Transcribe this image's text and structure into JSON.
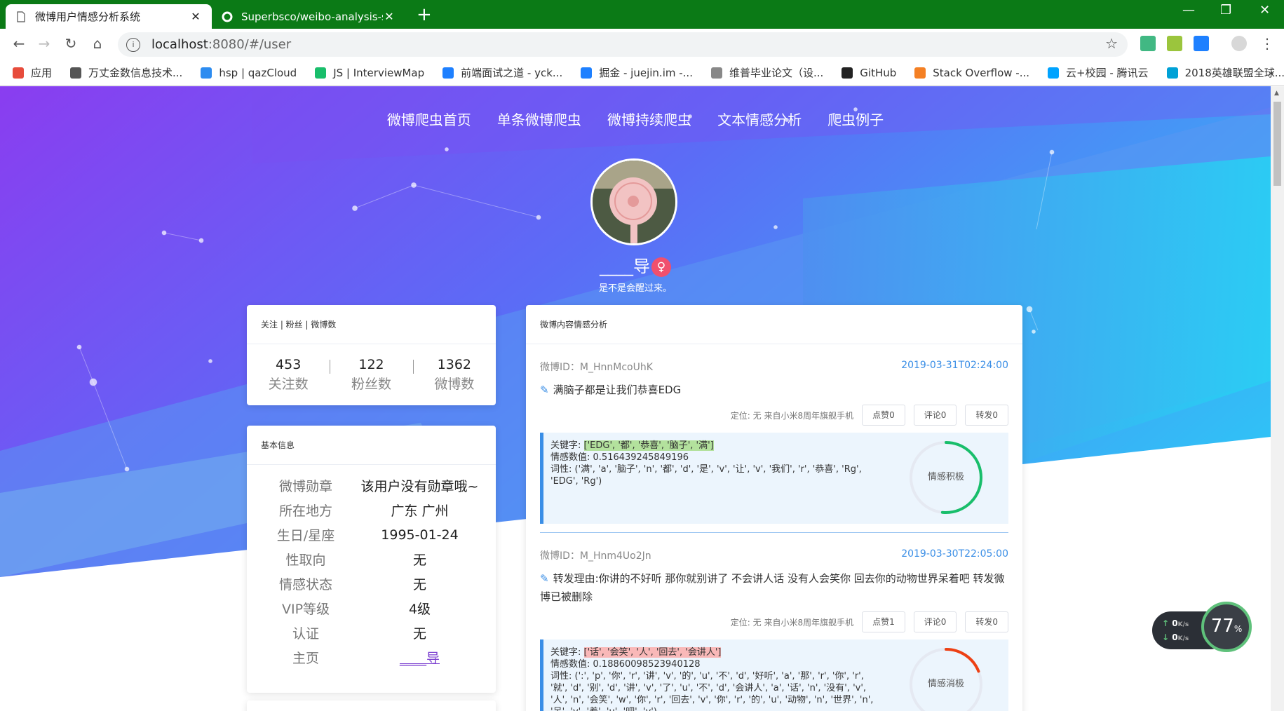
{
  "browser": {
    "tabs": [
      {
        "title": "微博用户情感分析系统",
        "close": "✕"
      },
      {
        "title": "Superbsco/weibo-analysis-syst",
        "close": "✕"
      }
    ],
    "new_tab": "+",
    "url_host": "localhost",
    "url_rest": ":8080/#/user",
    "bookmarks": [
      {
        "label": "应用",
        "icon": "apps-icon",
        "color": "#e74c3c"
      },
      {
        "label": "万丈金数信息技术...",
        "icon": "aws-icon",
        "color": "#555555"
      },
      {
        "label": "hsp | qazCloud",
        "icon": "cloud-icon",
        "color": "#2d8cf0"
      },
      {
        "label": "JS | InterviewMap",
        "icon": "map-icon",
        "color": "#19be6b"
      },
      {
        "label": "前端面试之道 - yck...",
        "icon": "juejin-icon",
        "color": "#1e80ff"
      },
      {
        "label": "掘金 - juejin.im -...",
        "icon": "juejin-icon",
        "color": "#1e80ff"
      },
      {
        "label": "维普毕业论文（设...",
        "icon": "doc-icon",
        "color": "#888888"
      },
      {
        "label": "GitHub",
        "icon": "github-icon",
        "color": "#222222"
      },
      {
        "label": "Stack Overflow -...",
        "icon": "stackoverflow-icon",
        "color": "#f48024"
      },
      {
        "label": "云+校园 - 腾讯云",
        "icon": "tencent-cloud-icon",
        "color": "#00a3ff"
      },
      {
        "label": "2018英雄联盟全球...",
        "icon": "bilibili-icon",
        "color": "#00a1d6"
      }
    ],
    "bookmarks_more": "»"
  },
  "nav": [
    "微博爬虫首页",
    "单条微博爬虫",
    "微博持续爬虫",
    "文本情感分析",
    "爬虫例子"
  ],
  "profile": {
    "name": "____导",
    "gender_symbol": "♀",
    "bio": "是不是会醒过来。"
  },
  "stats_card": {
    "title": "关注 | 粉丝 | 微博数",
    "items": [
      {
        "value": "453",
        "label": "关注数"
      },
      {
        "value": "122",
        "label": "粉丝数"
      },
      {
        "value": "1362",
        "label": "微博数"
      }
    ]
  },
  "info_card": {
    "title": "基本信息",
    "rows": [
      {
        "key": "微博勋章",
        "value": "该用户没有勋章哦~"
      },
      {
        "key": "所在地方",
        "value": "广东 广州"
      },
      {
        "key": "生日/星座",
        "value": "1995-01-24"
      },
      {
        "key": "性取向",
        "value": "无"
      },
      {
        "key": "情感状态",
        "value": "无"
      },
      {
        "key": "VIP等级",
        "value": "4级"
      },
      {
        "key": "认证",
        "value": "无"
      },
      {
        "key": "主页",
        "value": "____导"
      }
    ]
  },
  "analysis_card": {
    "title": "微博内容情感分析",
    "posts": [
      {
        "id": "微博ID：M_HnnMcoUhK",
        "date": "2019-03-31T02:24:00",
        "text": "满脑子都是让我们恭喜EDG",
        "location": "定位: 无 来自小米8周年旗舰手机",
        "like": "点赞0",
        "comment": "评论0",
        "repost": "转发0",
        "kw_label": "关键字:",
        "keywords": "['EDG', '都', '恭喜', '脑子', '满']",
        "score_label": "情感数值:",
        "score": "0.516439245849196",
        "pos_label": "词性:",
        "pos": "('满', 'a', '脑子', 'n', '都', 'd', '是', 'v', '让', 'v', '我们', 'r', '恭喜', 'Rg', 'EDG', 'Rg')",
        "sentiment": "情感积极",
        "sentiment_value": 0.516,
        "ring_color": "#19be6b"
      },
      {
        "id": "微博ID：M_Hnm4Uo2Jn",
        "date": "2019-03-30T22:05:00",
        "text": "转发理由:你讲的不好听 那你就别讲了 不会讲人话 没有人会笑你 回去你的动物世界呆着吧   转发微博已被删除",
        "location": "定位: 无 来自小米8周年旗舰手机",
        "like": "点赞1",
        "comment": "评论0",
        "repost": "转发0",
        "kw_label": "关键字:",
        "keywords": "['话', '会笑', '人', '回去', '会讲人']",
        "score_label": "情感数值:",
        "score": "0.18860098523940128",
        "pos_label": "词性:",
        "pos": "(':', 'p', '你', 'r', '讲', 'v', '的', 'u', '不', 'd', '好听', 'a', '那', 'r', '你', 'r', '就', 'd', '别', 'd', '讲', 'v', '了', 'u', '不', 'd', '会讲人', 'a', '话', 'n', '没有', 'v', '人', 'n', '会笑', 'w', '你', 'r', '回去', 'v', '你', 'r', '的', 'u', '动物', 'n', '世界', 'n', '呆', 'v', '着', 'u', '吧', 'y')",
        "sentiment": "情感消极",
        "sentiment_value": 0.189,
        "ring_color": "#ed4014"
      }
    ]
  },
  "speed_widget": {
    "up": "0",
    "down": "0",
    "unit": "K/s",
    "percent": "77",
    "percent_sign": "%"
  }
}
